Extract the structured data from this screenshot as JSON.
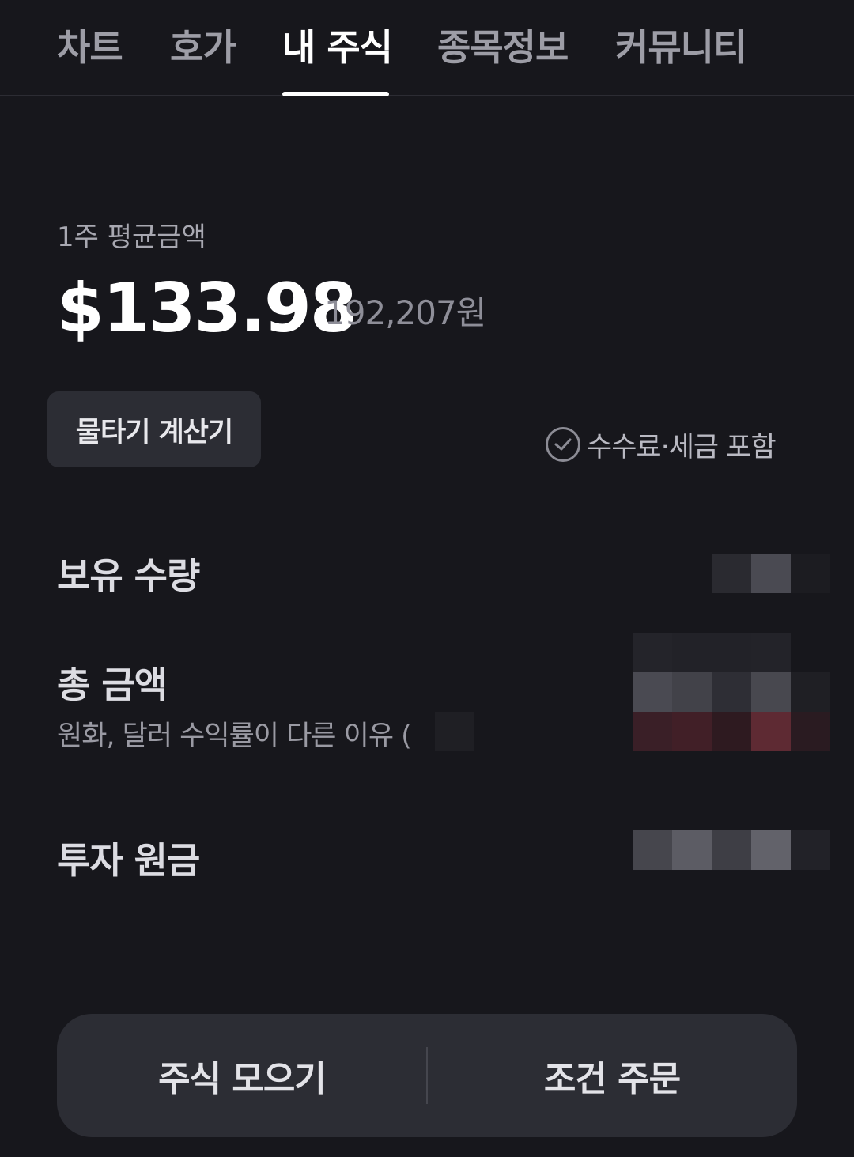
{
  "tabs": [
    {
      "label": "차트"
    },
    {
      "label": "호가"
    },
    {
      "label": "내 주식"
    },
    {
      "label": "종목정보"
    },
    {
      "label": "커뮤니티"
    }
  ],
  "active_tab": "내 주식",
  "summary": {
    "avg_label": "1주 평균금액",
    "avg_price_usd": "$133.98",
    "avg_price_krw": "192,207원"
  },
  "calc_button": "물타기 계산기",
  "fee_toggle": {
    "label": "수수료·세금 포함",
    "checked": false
  },
  "rows": {
    "quantity_label": "보유 수량",
    "total_label": "총 금액",
    "total_sub": "원화, 달러 수익률이 다른 이유 (",
    "principal_label": "투자 원금"
  },
  "bottom": {
    "left_label": "주식 모으기",
    "right_label": "조건 주문"
  },
  "colors": {
    "background": "#17171c",
    "card": "#2c2d34",
    "active_text": "#ffffff",
    "inactive_text": "#9d9da6"
  }
}
